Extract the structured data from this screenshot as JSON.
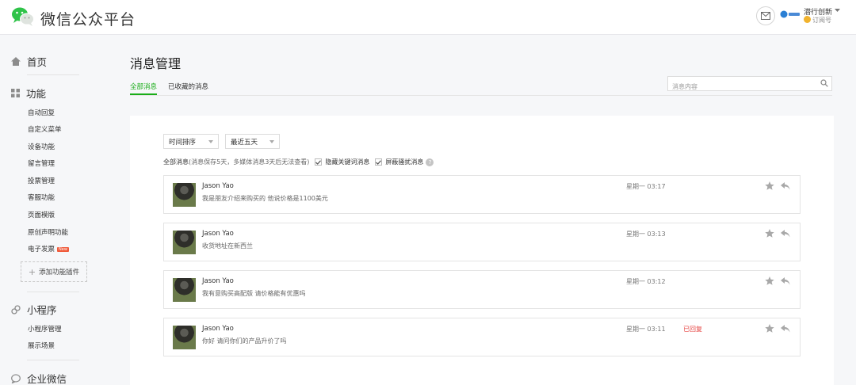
{
  "header": {
    "brand": "微信公众平台",
    "account_name": "潜行创新",
    "account_type": "订阅号"
  },
  "sidebar": {
    "home": "首页",
    "functions": {
      "title": "功能",
      "items": [
        "自动回复",
        "自定义菜单",
        "设备功能",
        "留言管理",
        "投票管理",
        "客服功能",
        "页面模版",
        "原创声明功能",
        "电子发票"
      ],
      "new_badge": "New",
      "add_plugin": "添加功能插件"
    },
    "miniprogram": {
      "title": "小程序",
      "items": [
        "小程序管理",
        "展示场景"
      ]
    },
    "enterprise": "企业微信"
  },
  "main": {
    "title": "消息管理",
    "tabs": [
      "全部消息",
      "已收藏的消息"
    ],
    "search": {
      "placeholder": "消息内容",
      "value": ""
    },
    "sort_select": "时间排序",
    "range_select": "最近五天",
    "filter": {
      "label": "全部消息",
      "note": "(消息保存5天，多媒体消息3天后无法查看)",
      "hide_keyword": "隐藏关键词消息",
      "block_spam": "屏蔽骚扰消息"
    },
    "messages": [
      {
        "sender": "Jason Yao",
        "content": "我是朋友介绍来购买的 他说价格是1100美元",
        "time": "星期一 03:17",
        "status": ""
      },
      {
        "sender": "Jason Yao",
        "content": "收货地址在新西兰",
        "time": "星期一 03:13",
        "status": ""
      },
      {
        "sender": "Jason Yao",
        "content": "我有意购买高配版 请价格能有优惠吗",
        "time": "星期一 03:12",
        "status": ""
      },
      {
        "sender": "Jason Yao",
        "content": "你好 请问你们的产品升价了吗",
        "time": "星期一 03:11",
        "status": "已回复"
      }
    ]
  },
  "colors": {
    "accent": "#1aad19",
    "replied": "#e64340"
  }
}
